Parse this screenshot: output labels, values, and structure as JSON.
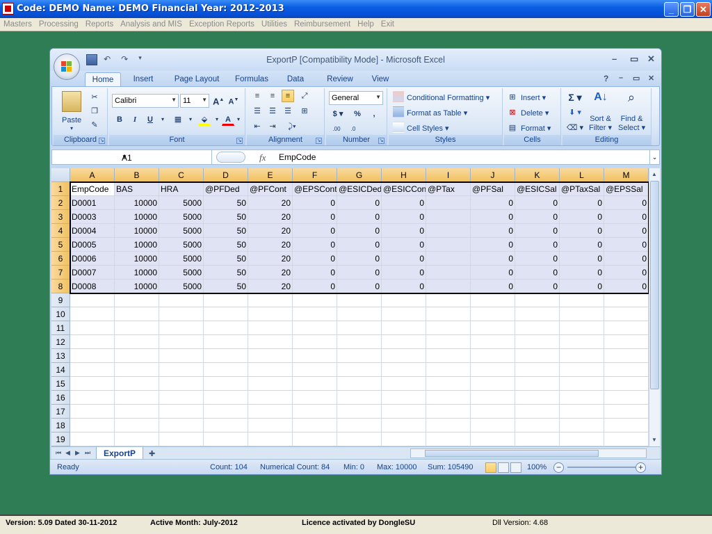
{
  "app": {
    "title": "Code: DEMO Name: DEMO Financial Year: 2012-2013",
    "menu": [
      "Masters",
      "Processing",
      "Reports",
      "Analysis and MIS",
      "Exception Reports",
      "Utilities",
      "Reimbursement",
      "Help",
      "Exit"
    ],
    "status": {
      "version": "Version: 5.09 Dated 30-11-2012",
      "active_month": "Active Month: July-2012",
      "licence": "Licence activated by DongleSU",
      "dll": "Dll Version: 4.68"
    }
  },
  "excel": {
    "title": "ExportP  [Compatibility Mode] - Microsoft Excel",
    "tabs": [
      "Home",
      "Insert",
      "Page Layout",
      "Formulas",
      "Data",
      "Review",
      "View"
    ],
    "ribbon": {
      "clipboard": {
        "label": "Clipboard",
        "paste": "Paste"
      },
      "font": {
        "label": "Font",
        "name": "Calibri",
        "size": "11"
      },
      "alignment": {
        "label": "Alignment"
      },
      "number": {
        "label": "Number",
        "format": "General"
      },
      "styles": {
        "label": "Styles",
        "conditional": "Conditional Formatting",
        "format_table": "Format as Table",
        "cell_styles": "Cell Styles"
      },
      "cells": {
        "label": "Cells",
        "insert": "Insert",
        "delete": "Delete",
        "format": "Format"
      },
      "editing": {
        "label": "Editing",
        "sort1": "Sort &",
        "sort2": "Filter",
        "find1": "Find &",
        "find2": "Select"
      }
    },
    "name_box": "A1",
    "formula": "EmpCode",
    "columns": [
      "A",
      "B",
      "C",
      "D",
      "E",
      "F",
      "G",
      "H",
      "I",
      "J",
      "K",
      "L",
      "M"
    ],
    "row_numbers": [
      "1",
      "2",
      "3",
      "4",
      "5",
      "6",
      "7",
      "8",
      "9",
      "10",
      "11",
      "12",
      "13",
      "14",
      "15",
      "16",
      "17",
      "18",
      "19"
    ],
    "headers": [
      "EmpCode",
      "BAS",
      "HRA",
      "@PFDed",
      "@PFCont",
      "@EPSCont",
      "@ESICDed",
      "@ESICCont",
      "@PTax",
      "@PFSal",
      "@ESICSal",
      "@PTaxSal",
      "@EPSSal"
    ],
    "rows": [
      [
        "D0001",
        "10000",
        "5000",
        "50",
        "20",
        "0",
        "0",
        "0",
        "",
        "0",
        "0",
        "0",
        "0"
      ],
      [
        "D0003",
        "10000",
        "5000",
        "50",
        "20",
        "0",
        "0",
        "0",
        "",
        "0",
        "0",
        "0",
        "0"
      ],
      [
        "D0004",
        "10000",
        "5000",
        "50",
        "20",
        "0",
        "0",
        "0",
        "",
        "0",
        "0",
        "0",
        "0"
      ],
      [
        "D0005",
        "10000",
        "5000",
        "50",
        "20",
        "0",
        "0",
        "0",
        "",
        "0",
        "0",
        "0",
        "0"
      ],
      [
        "D0006",
        "10000",
        "5000",
        "50",
        "20",
        "0",
        "0",
        "0",
        "",
        "0",
        "0",
        "0",
        "0"
      ],
      [
        "D0007",
        "10000",
        "5000",
        "50",
        "20",
        "0",
        "0",
        "0",
        "",
        "0",
        "0",
        "0",
        "0"
      ],
      [
        "D0008",
        "10000",
        "5000",
        "50",
        "20",
        "0",
        "0",
        "0",
        "",
        "0",
        "0",
        "0",
        "0"
      ]
    ],
    "sheet_tab": "ExportP",
    "statusbar": {
      "ready": "Ready",
      "count": "Count: 104",
      "numerical_count": "Numerical Count: 84",
      "min": "Min: 0",
      "max": "Max: 10000",
      "sum": "Sum: 105490",
      "zoom": "100%"
    }
  }
}
